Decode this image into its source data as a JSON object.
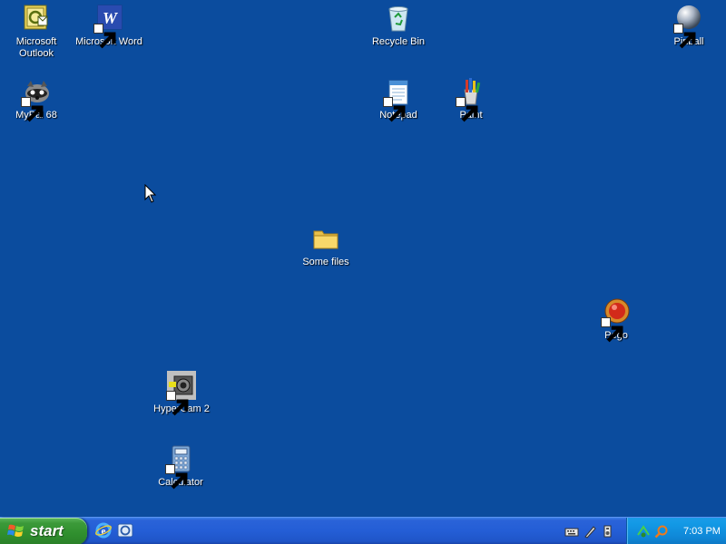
{
  "desktop": {
    "background_color": "#0b4c9e",
    "icons": [
      {
        "label": "Microsoft Outlook",
        "icon": "outlook-icon"
      },
      {
        "label": "Microsoft Word",
        "icon": "word-icon"
      },
      {
        "label": "Recycle Bin",
        "icon": "recycle-bin-icon"
      },
      {
        "label": "Pinball",
        "icon": "pinball-icon"
      },
      {
        "label": "MyPal 68",
        "icon": "mypal-icon"
      },
      {
        "label": "Notepad",
        "icon": "notepad-icon"
      },
      {
        "label": "Paint",
        "icon": "paint-icon"
      },
      {
        "label": "Some files",
        "icon": "folder-icon"
      },
      {
        "label": "Pego",
        "icon": "pego-icon"
      },
      {
        "label": "HyperCam 2",
        "icon": "hypercam-icon"
      },
      {
        "label": "Calculator",
        "icon": "calculator-icon"
      }
    ]
  },
  "taskbar": {
    "start_label": "start",
    "quick_launch": [
      "internet-explorer-icon",
      "outlook-express-icon"
    ],
    "tray_icons": [
      "keyboard-icon",
      "pen-icon",
      "speaker-icon",
      "network-icon",
      "search-icon"
    ],
    "clock": "7:03 PM"
  }
}
